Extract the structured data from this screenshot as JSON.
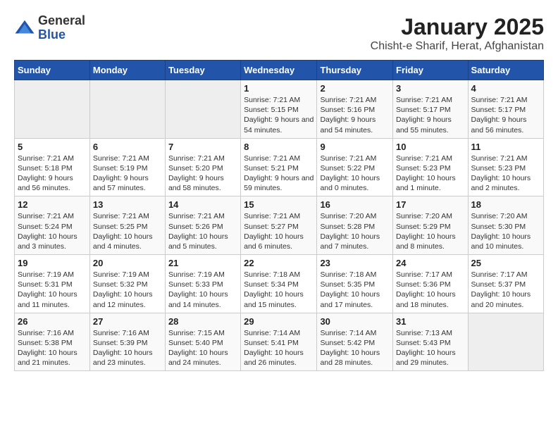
{
  "logo": {
    "general": "General",
    "blue": "Blue"
  },
  "title": "January 2025",
  "subtitle": "Chisht-e Sharif, Herat, Afghanistan",
  "days_of_week": [
    "Sunday",
    "Monday",
    "Tuesday",
    "Wednesday",
    "Thursday",
    "Friday",
    "Saturday"
  ],
  "weeks": [
    [
      {
        "day": "",
        "empty": true
      },
      {
        "day": "",
        "empty": true
      },
      {
        "day": "",
        "empty": true
      },
      {
        "day": "1",
        "sunrise": "7:21 AM",
        "sunset": "5:15 PM",
        "daylight": "9 hours and 54 minutes."
      },
      {
        "day": "2",
        "sunrise": "7:21 AM",
        "sunset": "5:16 PM",
        "daylight": "9 hours and 54 minutes."
      },
      {
        "day": "3",
        "sunrise": "7:21 AM",
        "sunset": "5:17 PM",
        "daylight": "9 hours and 55 minutes."
      },
      {
        "day": "4",
        "sunrise": "7:21 AM",
        "sunset": "5:17 PM",
        "daylight": "9 hours and 56 minutes."
      }
    ],
    [
      {
        "day": "5",
        "sunrise": "7:21 AM",
        "sunset": "5:18 PM",
        "daylight": "9 hours and 56 minutes."
      },
      {
        "day": "6",
        "sunrise": "7:21 AM",
        "sunset": "5:19 PM",
        "daylight": "9 hours and 57 minutes."
      },
      {
        "day": "7",
        "sunrise": "7:21 AM",
        "sunset": "5:20 PM",
        "daylight": "9 hours and 58 minutes."
      },
      {
        "day": "8",
        "sunrise": "7:21 AM",
        "sunset": "5:21 PM",
        "daylight": "9 hours and 59 minutes."
      },
      {
        "day": "9",
        "sunrise": "7:21 AM",
        "sunset": "5:22 PM",
        "daylight": "10 hours and 0 minutes."
      },
      {
        "day": "10",
        "sunrise": "7:21 AM",
        "sunset": "5:23 PM",
        "daylight": "10 hours and 1 minute."
      },
      {
        "day": "11",
        "sunrise": "7:21 AM",
        "sunset": "5:23 PM",
        "daylight": "10 hours and 2 minutes."
      }
    ],
    [
      {
        "day": "12",
        "sunrise": "7:21 AM",
        "sunset": "5:24 PM",
        "daylight": "10 hours and 3 minutes."
      },
      {
        "day": "13",
        "sunrise": "7:21 AM",
        "sunset": "5:25 PM",
        "daylight": "10 hours and 4 minutes."
      },
      {
        "day": "14",
        "sunrise": "7:21 AM",
        "sunset": "5:26 PM",
        "daylight": "10 hours and 5 minutes."
      },
      {
        "day": "15",
        "sunrise": "7:21 AM",
        "sunset": "5:27 PM",
        "daylight": "10 hours and 6 minutes."
      },
      {
        "day": "16",
        "sunrise": "7:20 AM",
        "sunset": "5:28 PM",
        "daylight": "10 hours and 7 minutes."
      },
      {
        "day": "17",
        "sunrise": "7:20 AM",
        "sunset": "5:29 PM",
        "daylight": "10 hours and 8 minutes."
      },
      {
        "day": "18",
        "sunrise": "7:20 AM",
        "sunset": "5:30 PM",
        "daylight": "10 hours and 10 minutes."
      }
    ],
    [
      {
        "day": "19",
        "sunrise": "7:19 AM",
        "sunset": "5:31 PM",
        "daylight": "10 hours and 11 minutes."
      },
      {
        "day": "20",
        "sunrise": "7:19 AM",
        "sunset": "5:32 PM",
        "daylight": "10 hours and 12 minutes."
      },
      {
        "day": "21",
        "sunrise": "7:19 AM",
        "sunset": "5:33 PM",
        "daylight": "10 hours and 14 minutes."
      },
      {
        "day": "22",
        "sunrise": "7:18 AM",
        "sunset": "5:34 PM",
        "daylight": "10 hours and 15 minutes."
      },
      {
        "day": "23",
        "sunrise": "7:18 AM",
        "sunset": "5:35 PM",
        "daylight": "10 hours and 17 minutes."
      },
      {
        "day": "24",
        "sunrise": "7:17 AM",
        "sunset": "5:36 PM",
        "daylight": "10 hours and 18 minutes."
      },
      {
        "day": "25",
        "sunrise": "7:17 AM",
        "sunset": "5:37 PM",
        "daylight": "10 hours and 20 minutes."
      }
    ],
    [
      {
        "day": "26",
        "sunrise": "7:16 AM",
        "sunset": "5:38 PM",
        "daylight": "10 hours and 21 minutes."
      },
      {
        "day": "27",
        "sunrise": "7:16 AM",
        "sunset": "5:39 PM",
        "daylight": "10 hours and 23 minutes."
      },
      {
        "day": "28",
        "sunrise": "7:15 AM",
        "sunset": "5:40 PM",
        "daylight": "10 hours and 24 minutes."
      },
      {
        "day": "29",
        "sunrise": "7:14 AM",
        "sunset": "5:41 PM",
        "daylight": "10 hours and 26 minutes."
      },
      {
        "day": "30",
        "sunrise": "7:14 AM",
        "sunset": "5:42 PM",
        "daylight": "10 hours and 28 minutes."
      },
      {
        "day": "31",
        "sunrise": "7:13 AM",
        "sunset": "5:43 PM",
        "daylight": "10 hours and 29 minutes."
      },
      {
        "day": "",
        "empty": true
      }
    ]
  ]
}
